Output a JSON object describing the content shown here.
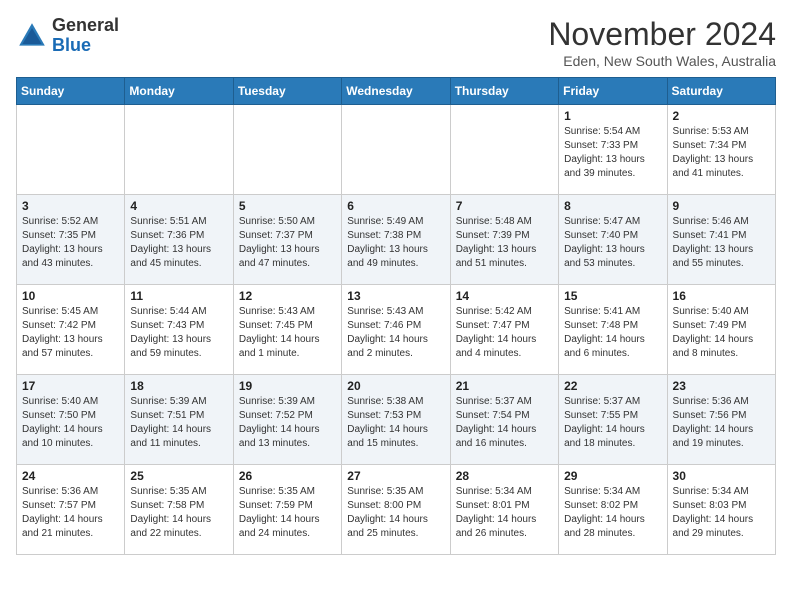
{
  "header": {
    "logo_line1": "General",
    "logo_line2": "Blue",
    "month": "November 2024",
    "location": "Eden, New South Wales, Australia"
  },
  "weekdays": [
    "Sunday",
    "Monday",
    "Tuesday",
    "Wednesday",
    "Thursday",
    "Friday",
    "Saturday"
  ],
  "weeks": [
    [
      {
        "day": "",
        "info": ""
      },
      {
        "day": "",
        "info": ""
      },
      {
        "day": "",
        "info": ""
      },
      {
        "day": "",
        "info": ""
      },
      {
        "day": "",
        "info": ""
      },
      {
        "day": "1",
        "info": "Sunrise: 5:54 AM\nSunset: 7:33 PM\nDaylight: 13 hours\nand 39 minutes."
      },
      {
        "day": "2",
        "info": "Sunrise: 5:53 AM\nSunset: 7:34 PM\nDaylight: 13 hours\nand 41 minutes."
      }
    ],
    [
      {
        "day": "3",
        "info": "Sunrise: 5:52 AM\nSunset: 7:35 PM\nDaylight: 13 hours\nand 43 minutes."
      },
      {
        "day": "4",
        "info": "Sunrise: 5:51 AM\nSunset: 7:36 PM\nDaylight: 13 hours\nand 45 minutes."
      },
      {
        "day": "5",
        "info": "Sunrise: 5:50 AM\nSunset: 7:37 PM\nDaylight: 13 hours\nand 47 minutes."
      },
      {
        "day": "6",
        "info": "Sunrise: 5:49 AM\nSunset: 7:38 PM\nDaylight: 13 hours\nand 49 minutes."
      },
      {
        "day": "7",
        "info": "Sunrise: 5:48 AM\nSunset: 7:39 PM\nDaylight: 13 hours\nand 51 minutes."
      },
      {
        "day": "8",
        "info": "Sunrise: 5:47 AM\nSunset: 7:40 PM\nDaylight: 13 hours\nand 53 minutes."
      },
      {
        "day": "9",
        "info": "Sunrise: 5:46 AM\nSunset: 7:41 PM\nDaylight: 13 hours\nand 55 minutes."
      }
    ],
    [
      {
        "day": "10",
        "info": "Sunrise: 5:45 AM\nSunset: 7:42 PM\nDaylight: 13 hours\nand 57 minutes."
      },
      {
        "day": "11",
        "info": "Sunrise: 5:44 AM\nSunset: 7:43 PM\nDaylight: 13 hours\nand 59 minutes."
      },
      {
        "day": "12",
        "info": "Sunrise: 5:43 AM\nSunset: 7:45 PM\nDaylight: 14 hours\nand 1 minute."
      },
      {
        "day": "13",
        "info": "Sunrise: 5:43 AM\nSunset: 7:46 PM\nDaylight: 14 hours\nand 2 minutes."
      },
      {
        "day": "14",
        "info": "Sunrise: 5:42 AM\nSunset: 7:47 PM\nDaylight: 14 hours\nand 4 minutes."
      },
      {
        "day": "15",
        "info": "Sunrise: 5:41 AM\nSunset: 7:48 PM\nDaylight: 14 hours\nand 6 minutes."
      },
      {
        "day": "16",
        "info": "Sunrise: 5:40 AM\nSunset: 7:49 PM\nDaylight: 14 hours\nand 8 minutes."
      }
    ],
    [
      {
        "day": "17",
        "info": "Sunrise: 5:40 AM\nSunset: 7:50 PM\nDaylight: 14 hours\nand 10 minutes."
      },
      {
        "day": "18",
        "info": "Sunrise: 5:39 AM\nSunset: 7:51 PM\nDaylight: 14 hours\nand 11 minutes."
      },
      {
        "day": "19",
        "info": "Sunrise: 5:39 AM\nSunset: 7:52 PM\nDaylight: 14 hours\nand 13 minutes."
      },
      {
        "day": "20",
        "info": "Sunrise: 5:38 AM\nSunset: 7:53 PM\nDaylight: 14 hours\nand 15 minutes."
      },
      {
        "day": "21",
        "info": "Sunrise: 5:37 AM\nSunset: 7:54 PM\nDaylight: 14 hours\nand 16 minutes."
      },
      {
        "day": "22",
        "info": "Sunrise: 5:37 AM\nSunset: 7:55 PM\nDaylight: 14 hours\nand 18 minutes."
      },
      {
        "day": "23",
        "info": "Sunrise: 5:36 AM\nSunset: 7:56 PM\nDaylight: 14 hours\nand 19 minutes."
      }
    ],
    [
      {
        "day": "24",
        "info": "Sunrise: 5:36 AM\nSunset: 7:57 PM\nDaylight: 14 hours\nand 21 minutes."
      },
      {
        "day": "25",
        "info": "Sunrise: 5:35 AM\nSunset: 7:58 PM\nDaylight: 14 hours\nand 22 minutes."
      },
      {
        "day": "26",
        "info": "Sunrise: 5:35 AM\nSunset: 7:59 PM\nDaylight: 14 hours\nand 24 minutes."
      },
      {
        "day": "27",
        "info": "Sunrise: 5:35 AM\nSunset: 8:00 PM\nDaylight: 14 hours\nand 25 minutes."
      },
      {
        "day": "28",
        "info": "Sunrise: 5:34 AM\nSunset: 8:01 PM\nDaylight: 14 hours\nand 26 minutes."
      },
      {
        "day": "29",
        "info": "Sunrise: 5:34 AM\nSunset: 8:02 PM\nDaylight: 14 hours\nand 28 minutes."
      },
      {
        "day": "30",
        "info": "Sunrise: 5:34 AM\nSunset: 8:03 PM\nDaylight: 14 hours\nand 29 minutes."
      }
    ]
  ]
}
